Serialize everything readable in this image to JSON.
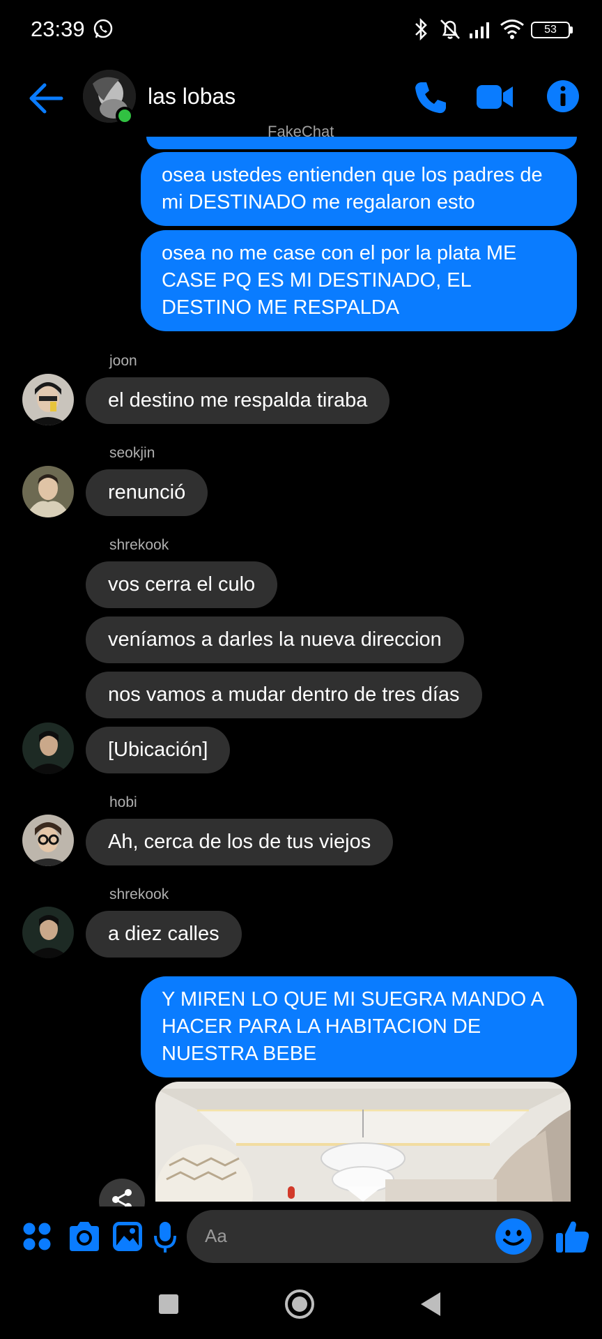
{
  "status_bar": {
    "time": "23:39",
    "battery": "53"
  },
  "header": {
    "title": "las lobas",
    "watermark": "FakeChat"
  },
  "messages": {
    "out_1": "osea ustedes entienden que los padres de mi DESTINADO me regalaron esto",
    "out_2": "osea no me case con el por la plata ME CASE PQ ES MI DESTINADO, EL DESTINO ME RESPALDA",
    "sender_joon": "joon",
    "joon_1": "el destino me respalda tiraba",
    "sender_seokjin": "seokjin",
    "seokjin_1": "renunció",
    "sender_shrekook_1": "shrekook",
    "shrekook_1": "vos cerra el culo",
    "shrekook_2": "veníamos a darles la nueva direccion",
    "shrekook_3": "nos vamos a mudar dentro de tres días",
    "shrekook_4": "[Ubicación]",
    "sender_hobi": "hobi",
    "hobi_1": "Ah, cerca de los de tus viejos",
    "sender_shrekook_2": "shrekook",
    "shrekook_5": "a diez calles",
    "out_3": "Y MIREN LO QUE MI SUEGRA MANDO A HACER PARA LA HABITACION DE NUESTRA BEBE"
  },
  "composer": {
    "placeholder": "Aa"
  },
  "colors": {
    "accent": "#0a7cff",
    "incoming_bubble": "#303030",
    "online": "#31c142",
    "background": "#000000"
  },
  "icons": {
    "status": [
      "whatsapp-icon",
      "bluetooth-icon",
      "mute-icon",
      "signal-icon",
      "wifi-icon",
      "battery-icon"
    ],
    "header": [
      "back-arrow-icon",
      "phone-icon",
      "video-icon",
      "info-icon"
    ],
    "composer": [
      "apps-icon",
      "camera-icon",
      "gallery-icon",
      "mic-icon",
      "emoji-icon",
      "like-icon"
    ],
    "nav": [
      "recents-icon",
      "home-icon",
      "back-icon"
    ]
  }
}
